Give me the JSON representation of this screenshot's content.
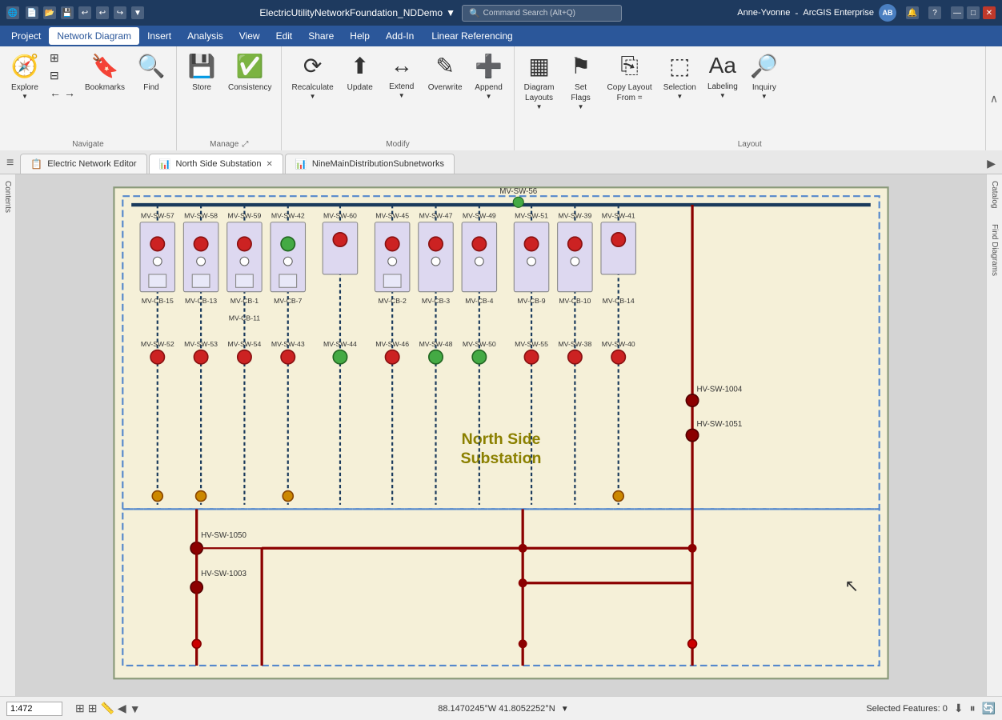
{
  "titlebar": {
    "app_name": "ArcGIS Enterprise",
    "filename": "ElectricUtilityNetworkFoundation_NDDemo",
    "search_placeholder": "Command Search (Alt+Q)",
    "user": "Anne-Yvonne",
    "user_initials": "AB"
  },
  "menubar": {
    "items": [
      "Project",
      "Network Diagram",
      "Insert",
      "Analysis",
      "View",
      "Edit",
      "Share",
      "Help",
      "Add-In"
    ],
    "active": "Network Diagram",
    "special": "Linear Referencing"
  },
  "ribbon": {
    "groups": [
      {
        "label": "Navigate",
        "buttons": [
          {
            "label": "Explore",
            "icon": "🧭"
          },
          {
            "label": "",
            "icon": "⊞"
          },
          {
            "label": "Bookmarks",
            "icon": "📌"
          },
          {
            "label": "Find",
            "icon": "🔍"
          }
        ]
      },
      {
        "label": "Manage",
        "buttons": [
          {
            "label": "Store",
            "icon": "💾"
          },
          {
            "label": "Consistency",
            "icon": "✓"
          }
        ],
        "expand": true
      },
      {
        "label": "Modify",
        "buttons": [
          {
            "label": "Recalculate",
            "icon": "⟳"
          },
          {
            "label": "Update",
            "icon": "↑"
          },
          {
            "label": "Extend",
            "icon": "↔"
          },
          {
            "label": "Overwrite",
            "icon": "✎"
          },
          {
            "label": "Append",
            "icon": "➕"
          }
        ]
      },
      {
        "label": "Layout",
        "buttons": [
          {
            "label": "Diagram Layouts",
            "icon": "▦"
          },
          {
            "label": "Set Flags",
            "icon": "⚑"
          },
          {
            "label": "Copy Layout From",
            "icon": "⎘"
          },
          {
            "label": "Selection",
            "icon": "⬚"
          },
          {
            "label": "Labeling",
            "icon": "Aa"
          },
          {
            "label": "Inquiry",
            "icon": "?"
          }
        ]
      }
    ]
  },
  "tabs": [
    {
      "label": "Electric Network Editor",
      "icon": "📋",
      "active": false,
      "closeable": false
    },
    {
      "label": "North Side Substation",
      "icon": "📊",
      "active": true,
      "closeable": true
    },
    {
      "label": "NineMainDistributionSubnetworks",
      "icon": "📊",
      "active": false,
      "closeable": false
    }
  ],
  "sidebar": {
    "left_label": "Contents",
    "right_labels": [
      "Catalog",
      "Find Diagrams"
    ]
  },
  "diagram": {
    "substation_label": "North Side\nSubstation",
    "elements": {
      "mv_switches": [
        "MV-SW-56",
        "MV-SW-57",
        "MV-SW-58",
        "MV-SW-59",
        "MV-SW-42",
        "MV-SW-60",
        "MV-SW-45",
        "MV-SW-47",
        "MV-SW-49",
        "MV-SW-51",
        "MV-SW-39",
        "MV-SW-41",
        "MV-SW-52",
        "MV-SW-53",
        "MV-SW-54",
        "MV-SW-43",
        "MV-SW-44",
        "MV-SW-46",
        "MV-SW-48",
        "MV-SW-50",
        "MV-SW-55",
        "MV-SW-38",
        "MV-SW-40"
      ],
      "mv_cbs": [
        "MV-CB-15",
        "MV-CB-13",
        "MV-CB-1",
        "MV-CB-7",
        "MV-CB-2",
        "MV-CB-3",
        "MV-CB-4",
        "MV-CB-9",
        "MV-CB-10",
        "MV-CB-14",
        "MV-CB-11"
      ],
      "hv_switches": [
        "HV-SW-1004",
        "HV-SW-1051",
        "HV-SW-1050",
        "HV-SW-1003"
      ]
    }
  },
  "statusbar": {
    "scale": "1:472",
    "coordinates": "88.1470245°W 41.8052252°N",
    "selected_features": "Selected Features: 0"
  }
}
